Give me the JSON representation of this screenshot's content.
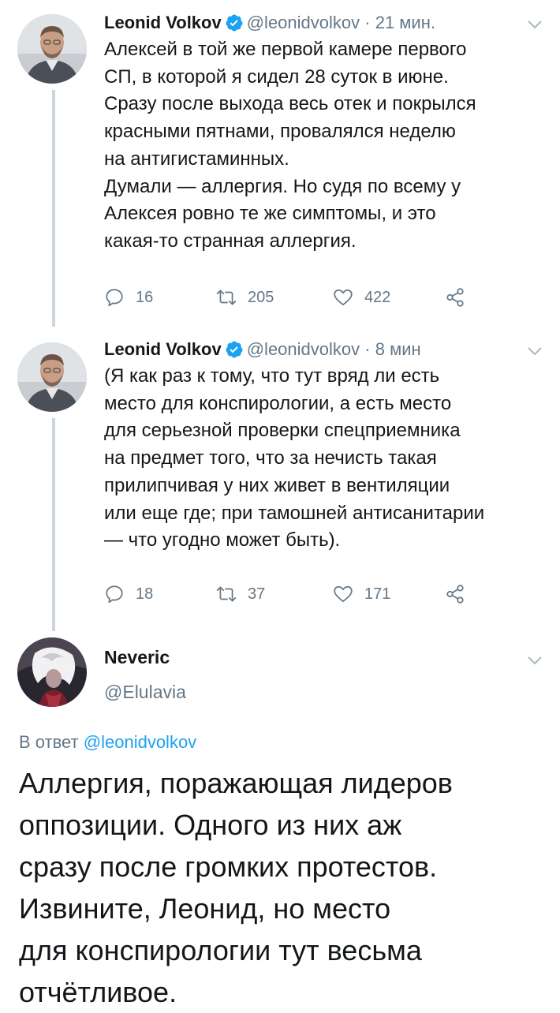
{
  "tweets": [
    {
      "name": "Leonid Volkov",
      "handle": "@leonidvolkov",
      "dot": "·",
      "time": "21 мин.",
      "text": "Алексей в той же первой камере первого\nСП, в которой я сидел 28 суток в июне.\nСразу после выхода весь отек и покрылся\nкрасными пятнами, провалялся неделю\nна антигистаминных.\nДумали — аллергия. Но судя по всему у\nАлексея ровно те же симптомы, и это\nкакая-то странная аллергия.",
      "replies": "16",
      "retweets": "205",
      "likes": "422"
    },
    {
      "name": "Leonid Volkov",
      "handle": "@leonidvolkov",
      "dot": "·",
      "time": "8 мин",
      "text": "(Я как раз к тому, что тут вряд ли есть\nместо для конспирологии, а есть место\nдля серьезной проверки спецприемника\nна предмет того, что за нечисть такая\nприлипчивая у них живет в вентиляции\nили еще где; при тамошней антисанитарии\n— что угодно может быть).",
      "replies": "18",
      "retweets": "37",
      "likes": "171"
    }
  ],
  "main_tweet": {
    "name": "Neveric",
    "handle": "@Elulavia",
    "reply_prefix": "В ответ",
    "reply_handle": "@leonidvolkov",
    "text": "Аллергия, поражающая лидеров\nоппозиции. Одного из них аж\nсразу после громких протестов.\nИзвините, Леонид, но место\nдля конспирологии тут весьма\nотчётливое."
  },
  "icons": {
    "reply": "reply-icon",
    "retweet": "retweet-icon",
    "like": "heart-icon",
    "share": "share-icon",
    "verified": "verified-badge-icon",
    "chevron": "chevron-down-icon"
  },
  "colors": {
    "text": "#14171a",
    "secondary": "#657786",
    "link": "#1da1f2",
    "thread_line": "#ccd6dd"
  }
}
